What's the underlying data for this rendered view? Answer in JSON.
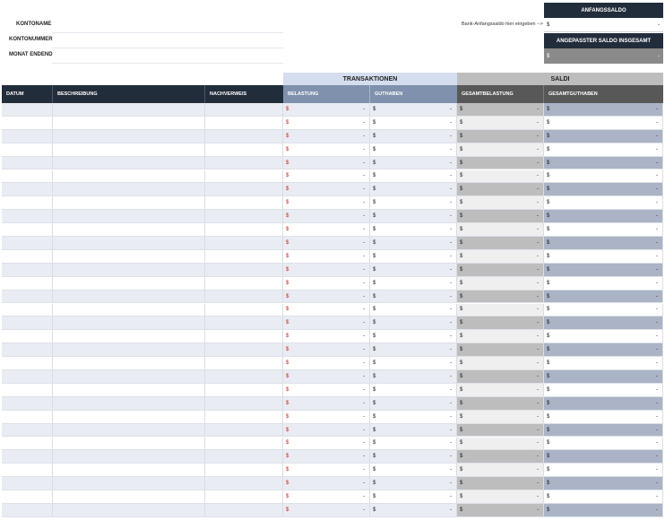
{
  "info": {
    "account_name_label": "KONTONAME",
    "account_number_label": "KONTONUMMER",
    "month_ending_label": "MONAT ENDEND",
    "account_name_value": "",
    "account_number_value": "",
    "month_ending_value": ""
  },
  "opening": {
    "header": "ANFANGSSALDO",
    "hint": "Bank-Anfangssaldo hier eingeben -->",
    "currency": "$",
    "value": "-"
  },
  "adjusted": {
    "header": "ANGEPASSTER SALDO INSGESAMT",
    "currency": "$",
    "value": "-"
  },
  "groups": {
    "transactions": "TRANSAKTIONEN",
    "balances": "SALDI"
  },
  "columns": {
    "date": "DATUM",
    "description": "BESCHREIBUNG",
    "reference": "NACHVERWEIS",
    "debit": "BELASTUNG",
    "credit": "GUTHABEN",
    "total_debit": "GESAMTBELASTUNG",
    "total_credit": "GESAMTGUTHABEN"
  },
  "row_template": {
    "currency": "$",
    "empty_value": "-"
  },
  "row_count": 31,
  "colors": {
    "dark_header": "#222d3c",
    "transactions_group": "#d5deee",
    "transactions_header": "#7f91ac",
    "balances_group": "#bdbdbd",
    "balances_header": "#585858",
    "debit_currency": "#d32020"
  }
}
